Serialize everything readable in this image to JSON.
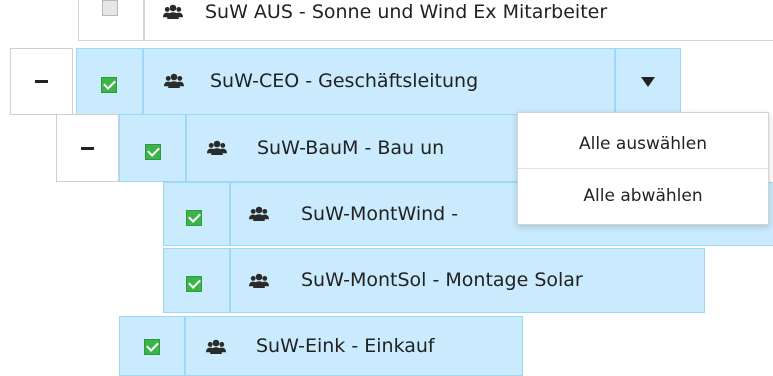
{
  "tree": {
    "rows": [
      {
        "label": "SuW AUS - Sonne und Wind Ex Mitarbeiter",
        "checked": false
      },
      {
        "label": "SuW-CEO - Geschäftsleitung",
        "checked": true
      },
      {
        "label": "SuW-BauM - Bau un",
        "checked": true
      },
      {
        "label": "SuW-MontWind - ",
        "checked": true
      },
      {
        "label": "SuW-MontSol - Montage Solar",
        "checked": true
      },
      {
        "label": "SuW-Eink - Einkauf",
        "checked": true
      }
    ]
  },
  "dropdown_menu": {
    "items": [
      {
        "label": "Alle auswählen"
      },
      {
        "label": "Alle abwählen"
      }
    ]
  },
  "colors": {
    "row_bg": "#c9ebfd",
    "row_border": "#9ed8f7",
    "checkbox_checked": "#3bb54a"
  },
  "icons": {
    "group": "users-group-icon",
    "collapse": "minus-icon",
    "dropdown": "caret-down-icon"
  }
}
